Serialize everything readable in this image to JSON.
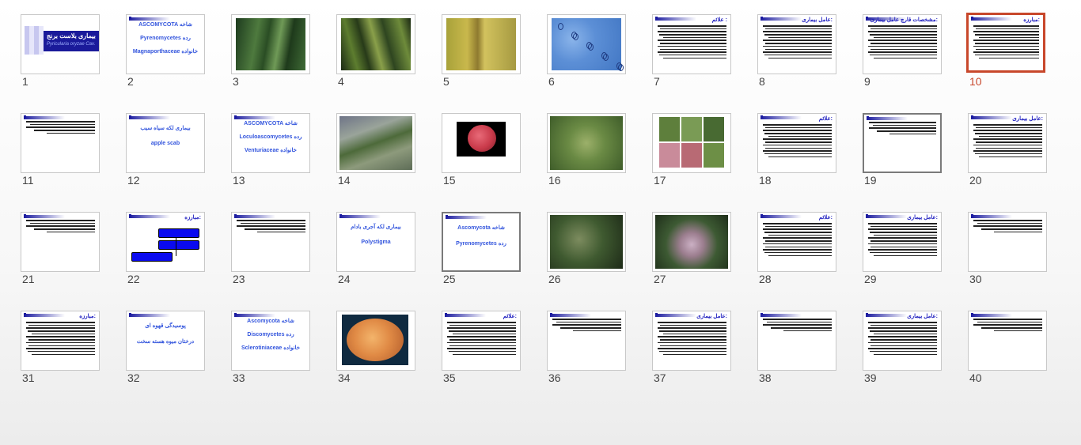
{
  "slides": [
    {
      "n": "1",
      "kind": "title1",
      "text": "بیماری بلاست برنج",
      "sub": "Pyricularia oryzae Cav."
    },
    {
      "n": "2",
      "kind": "text3",
      "lines": [
        "ASCOMYCOTA شاخه",
        "Pyrenomycetes رده",
        "Magnaporthaceae خانواده"
      ]
    },
    {
      "n": "3",
      "kind": "photo",
      "palette": "leafdark"
    },
    {
      "n": "4",
      "kind": "photo",
      "palette": "rice"
    },
    {
      "n": "5",
      "kind": "photo",
      "palette": "yellow"
    },
    {
      "n": "6",
      "kind": "photo",
      "palette": "blue"
    },
    {
      "n": "7",
      "kind": "textslide",
      "title": "علائم :"
    },
    {
      "n": "8",
      "kind": "textslide",
      "title": "عامل بیماری:"
    },
    {
      "n": "9",
      "kind": "textslide",
      "title": "مشخصات قارچ عامل بیماری:"
    },
    {
      "n": "10",
      "kind": "textslide",
      "title": "مبارزه:"
    },
    {
      "n": "11",
      "kind": "plain"
    },
    {
      "n": "12",
      "kind": "text2",
      "lines": [
        "بیماری لکه سیاه سیب",
        "apple scab"
      ]
    },
    {
      "n": "13",
      "kind": "text3",
      "lines": [
        "ASCOMYCOTA شاخه",
        "Loculoascomycetes رده",
        "Venturiaceae خانواده"
      ]
    },
    {
      "n": "14",
      "kind": "photo",
      "palette": "leafgray"
    },
    {
      "n": "15",
      "kind": "photo",
      "palette": "apple"
    },
    {
      "n": "16",
      "kind": "photo",
      "palette": "leafgreen"
    },
    {
      "n": "17",
      "kind": "photo",
      "palette": "grid4"
    },
    {
      "n": "18",
      "kind": "textslide",
      "title": "علائم:"
    },
    {
      "n": "19",
      "kind": "plain"
    },
    {
      "n": "20",
      "kind": "textslide",
      "title": "عامل بیماری:"
    },
    {
      "n": "21",
      "kind": "plain"
    },
    {
      "n": "22",
      "kind": "diagram",
      "title": "مبارزه:"
    },
    {
      "n": "23",
      "kind": "plain"
    },
    {
      "n": "24",
      "kind": "text2",
      "lines": [
        "بیماری لکه آجری بادام",
        "Polystigma"
      ]
    },
    {
      "n": "25",
      "kind": "text2",
      "lines": [
        "Ascomycota شاخه",
        "Pyrenomycetes رده"
      ]
    },
    {
      "n": "26",
      "kind": "photo",
      "palette": "leafdark2"
    },
    {
      "n": "27",
      "kind": "photo",
      "palette": "plum"
    },
    {
      "n": "28",
      "kind": "textslide",
      "title": "علائم:"
    },
    {
      "n": "29",
      "kind": "textslide",
      "title": "عامل بیماری:"
    },
    {
      "n": "30",
      "kind": "plain"
    },
    {
      "n": "31",
      "kind": "textslide",
      "title": "مبارزه:"
    },
    {
      "n": "32",
      "kind": "text2",
      "lines": [
        "پوسیدگی قهوه ای",
        "درختان میوه هسته سخت"
      ]
    },
    {
      "n": "33",
      "kind": "text3",
      "lines": [
        "Ascomycota شاخه",
        "Discomycetes رده",
        "Sclerotiniaceae خانواده"
      ]
    },
    {
      "n": "34",
      "kind": "photo",
      "palette": "peach"
    },
    {
      "n": "35",
      "kind": "textslide",
      "title": "علائم:"
    },
    {
      "n": "36",
      "kind": "plain"
    },
    {
      "n": "37",
      "kind": "textslide",
      "title": "عامل بیماری:"
    },
    {
      "n": "38",
      "kind": "plain"
    },
    {
      "n": "39",
      "kind": "textslide",
      "title": "عامل بیماری:"
    },
    {
      "n": "40",
      "kind": "plain"
    }
  ],
  "selected_red": "10",
  "selected_gray": [
    "19",
    "25"
  ],
  "colors": {
    "accent": "#c8472b",
    "title_blue": "#2020c0",
    "text_blue": "#3355dd"
  }
}
